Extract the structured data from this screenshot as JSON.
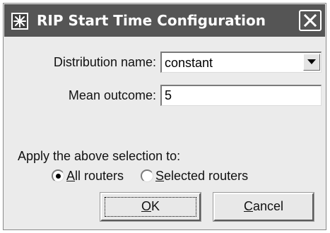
{
  "window": {
    "title": "RIP Start Time Configuration",
    "icon": "star-burst-icon",
    "close_icon": "close-icon"
  },
  "distribution": {
    "label": "Distribution name:",
    "selected": "constant",
    "arrow_icon": "chevron-down-icon"
  },
  "mean": {
    "label": "Mean outcome:",
    "value": "5"
  },
  "apply": {
    "label": "Apply the above selection to:",
    "options": [
      {
        "mnemonic": "A",
        "rest": "ll routers",
        "selected": true
      },
      {
        "mnemonic": "S",
        "rest": "elected routers",
        "selected": false
      }
    ]
  },
  "buttons": {
    "ok": {
      "mnemonic": "O",
      "rest": "K"
    },
    "cancel": {
      "mnemonic": "C",
      "rest": "ancel"
    }
  },
  "colors": {
    "titlebar": "#555555",
    "dialog_bg": "#ebebeb"
  }
}
